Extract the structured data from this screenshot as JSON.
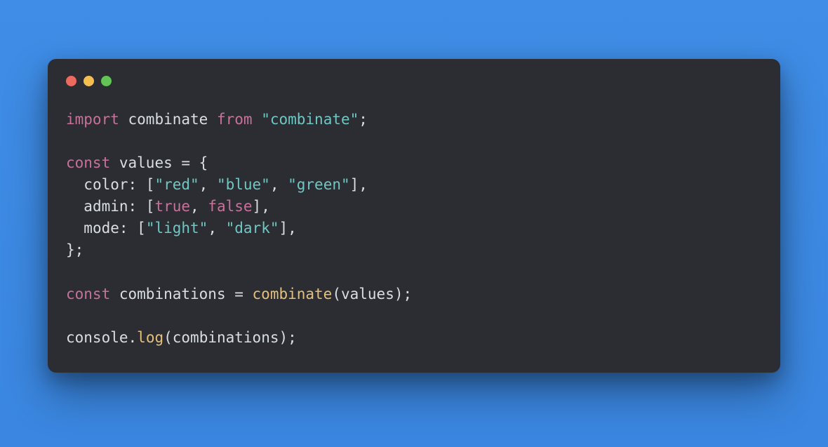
{
  "window": {
    "traffic_lights": [
      "red",
      "yellow",
      "green"
    ]
  },
  "code": {
    "line1": {
      "kw_import": "import",
      "id_combinate": "combinate",
      "kw_from": "from",
      "str_module": "\"combinate\"",
      "semi": ";"
    },
    "line3": {
      "kw_const": "const",
      "id_values": "values",
      "eq_open": " = {"
    },
    "line4": {
      "indent": "  ",
      "key": "color:",
      "pre": " [",
      "s1": "\"red\"",
      "c1": ", ",
      "s2": "\"blue\"",
      "c2": ", ",
      "s3": "\"green\"",
      "post": "],"
    },
    "line5": {
      "indent": "  ",
      "key": "admin:",
      "pre": " [",
      "b1": "true",
      "c1": ", ",
      "b2": "false",
      "post": "],"
    },
    "line6": {
      "indent": "  ",
      "key": "mode:",
      "pre": " [",
      "s1": "\"light\"",
      "c1": ", ",
      "s2": "\"dark\"",
      "post": "],"
    },
    "line7": {
      "close": "};"
    },
    "line9": {
      "kw_const": "const",
      "id_combinations": "combinations",
      "eq": " = ",
      "fn": "combinate",
      "args_open": "(",
      "arg": "values",
      "args_close": ");"
    },
    "line11": {
      "obj": "console",
      "dot": ".",
      "fn": "log",
      "args_open": "(",
      "arg": "combinations",
      "args_close": ");"
    }
  }
}
